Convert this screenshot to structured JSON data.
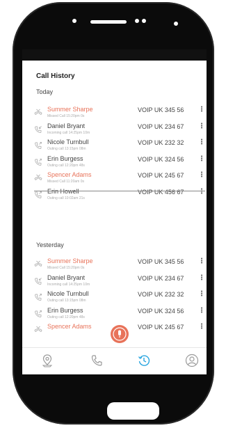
{
  "header": {
    "title": "Call History"
  },
  "sections": [
    {
      "label": "Today",
      "rows": [
        {
          "name": "Summer Sharpe",
          "sub": "Missed Call   15:20pm  0s",
          "number": "VOIP UK 345 56",
          "missed": true,
          "icon": "missed-call-icon"
        },
        {
          "name": "Daniel Bryant",
          "sub": "Incoming call  14:25pm  10m",
          "number": "VOIP UK 234 67",
          "missed": false,
          "icon": "incoming-call-icon"
        },
        {
          "name": "Nicole Turnbull",
          "sub": "Outing call    13:15pm  08m",
          "number": "VOIP UK 232 32",
          "missed": false,
          "icon": "outgoing-call-icon"
        },
        {
          "name": "Erin Burgess",
          "sub": "Outing call    12:20pm  48s",
          "number": "VOIP UK 324 56",
          "missed": false,
          "icon": "outgoing-call-icon"
        },
        {
          "name": "Spencer Adams",
          "sub": "Missed Call   11:20am  0s",
          "number": "VOIP UK 245 67",
          "missed": true,
          "icon": "missed-call-icon"
        },
        {
          "name": "Erin Howell",
          "sub": "Outing call    10:02am  21s",
          "number": "VOIP UK 456 67",
          "missed": false,
          "icon": "outgoing-call-icon"
        }
      ]
    },
    {
      "label": "Yesterday",
      "rows": [
        {
          "name": "Summer Sharpe",
          "sub": "Missed Call   15:20pm  0s",
          "number": "VOIP UK 345 56",
          "missed": true,
          "icon": "missed-call-icon"
        },
        {
          "name": "Daniel Bryant",
          "sub": "Incoming call  14:25pm  10m",
          "number": "VOIP UK 234 67",
          "missed": false,
          "icon": "incoming-call-icon"
        },
        {
          "name": "Nicole Turnbull",
          "sub": "Outing call    13:15pm  08m",
          "number": "VOIP UK 232 32",
          "missed": false,
          "icon": "outgoing-call-icon"
        },
        {
          "name": "Erin Burgess",
          "sub": "Outing call    12:20pm  48s",
          "number": "VOIP UK 324 56",
          "missed": false,
          "icon": "outgoing-call-icon"
        },
        {
          "name": "Spencer Adams",
          "sub": "",
          "number": "VOIP UK 245 67",
          "missed": true,
          "icon": "missed-call-icon"
        }
      ]
    }
  ],
  "row_menu_glyph": "⋮",
  "nav": {
    "items": [
      {
        "icon": "location-pin-icon",
        "active": false
      },
      {
        "icon": "phone-icon",
        "active": false
      },
      {
        "icon": "history-icon",
        "active": true
      },
      {
        "icon": "profile-icon",
        "active": false
      }
    ]
  },
  "mic": {
    "icon": "microphone-icon"
  },
  "colors": {
    "accent": "#e8735a",
    "active_nav": "#2aa6e0",
    "icon_grey": "#9a9a9a"
  }
}
